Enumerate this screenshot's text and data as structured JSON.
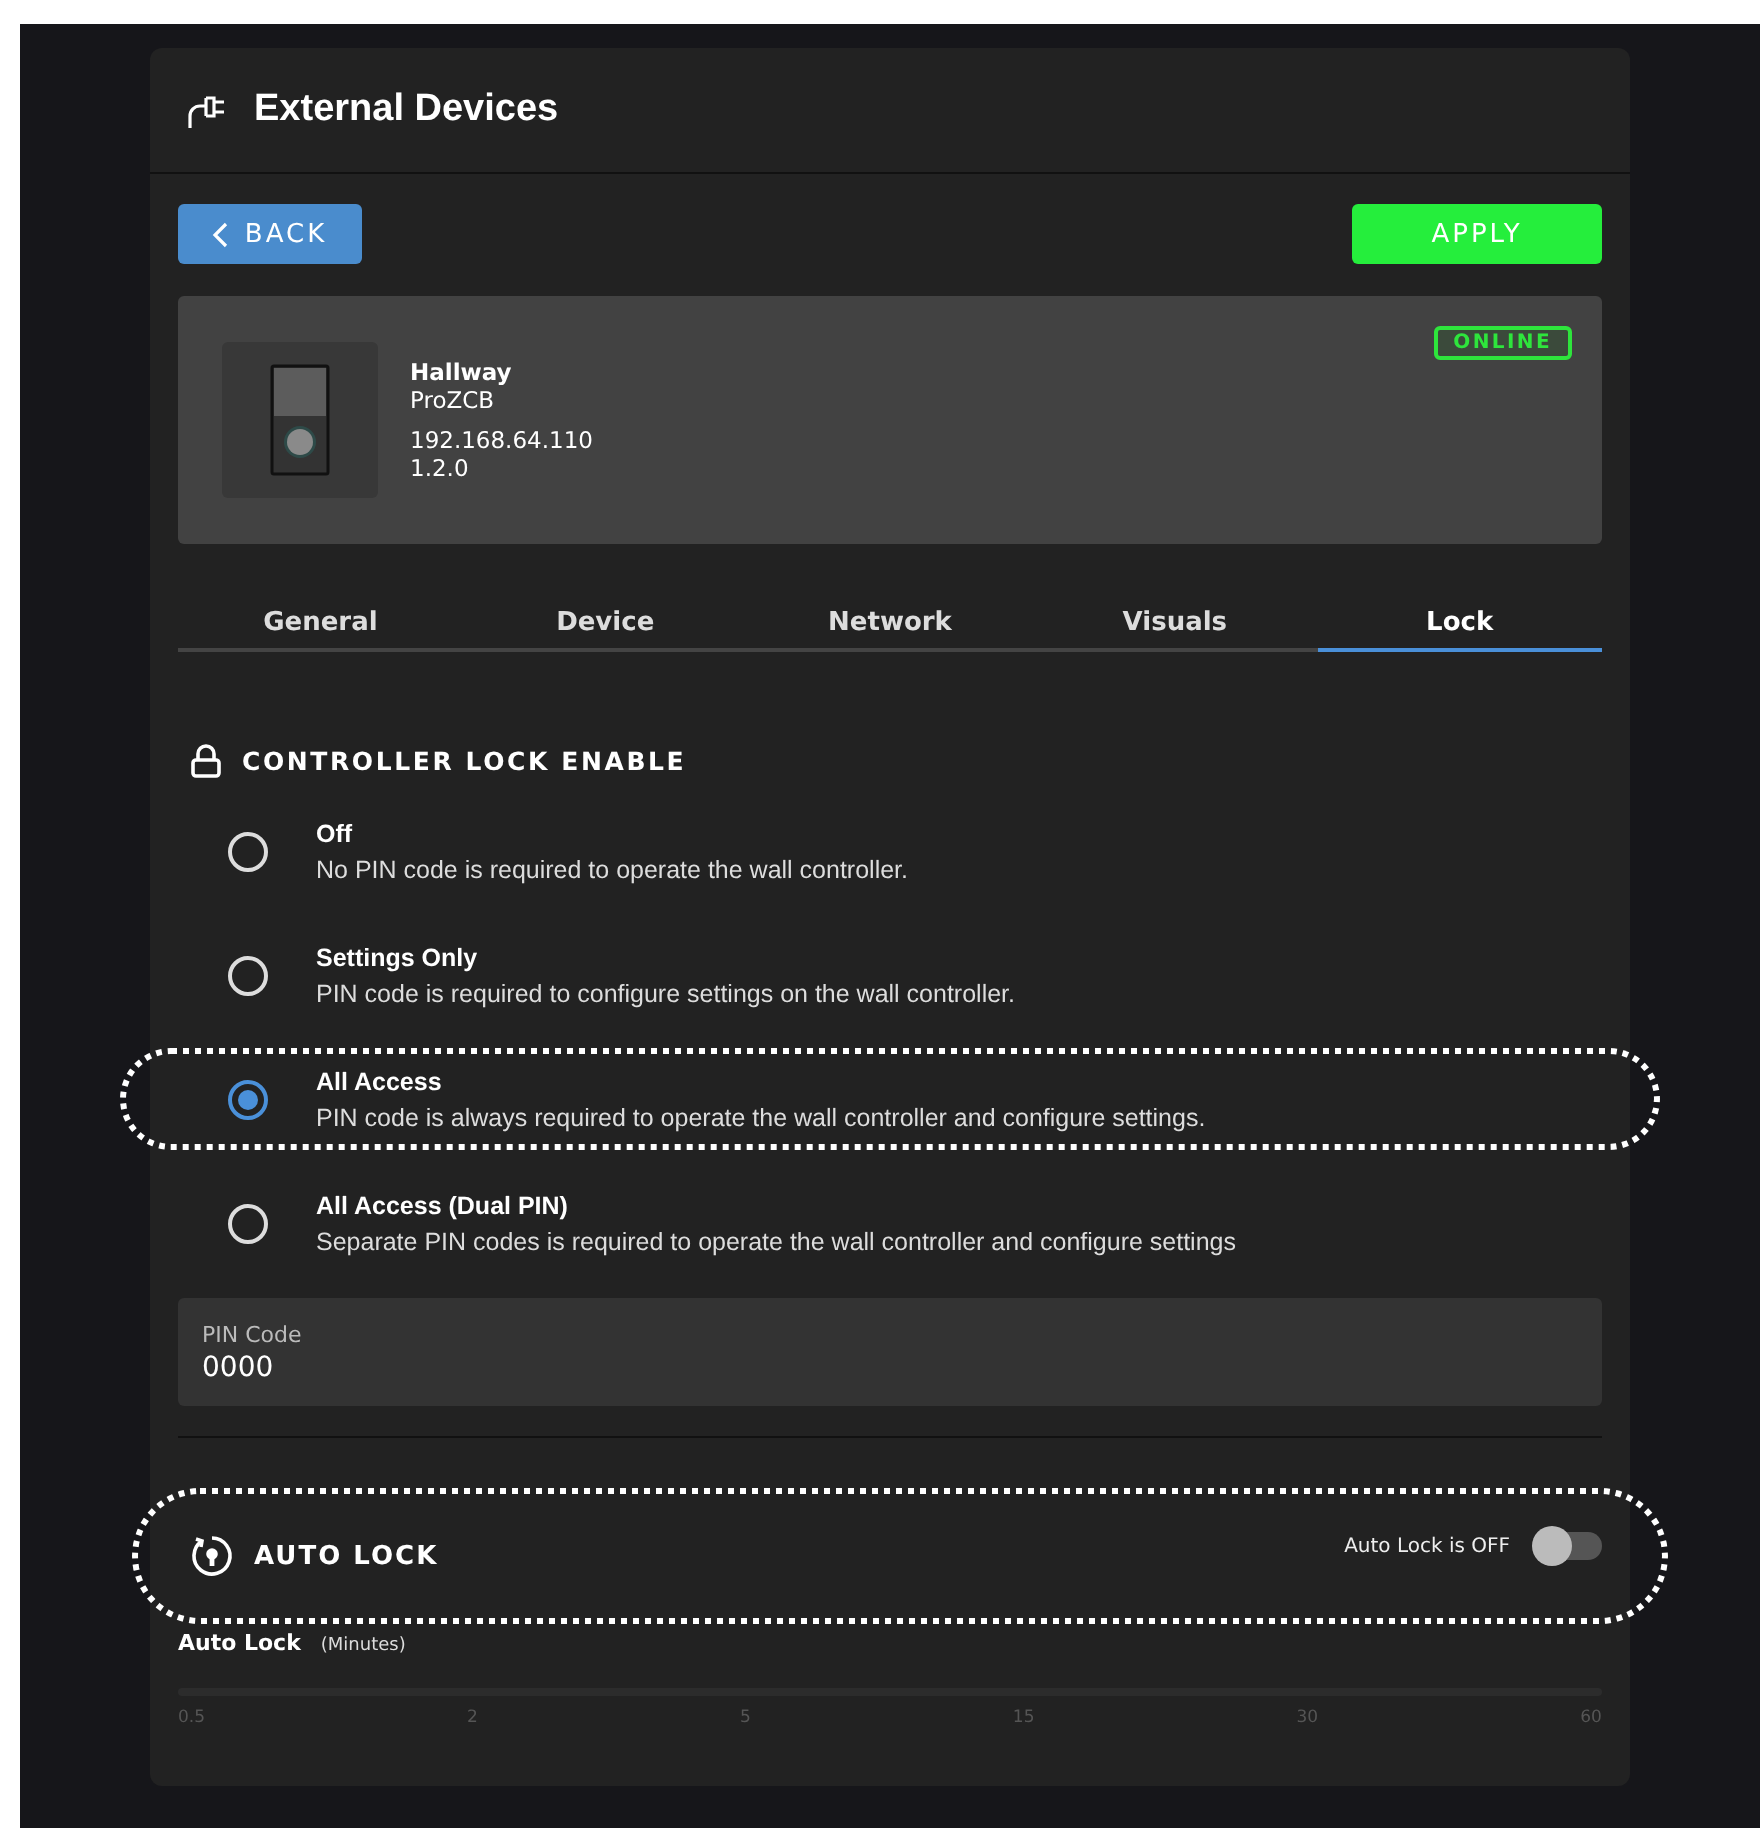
{
  "header": {
    "title": "External Devices"
  },
  "actions": {
    "back": "BACK",
    "apply": "APPLY"
  },
  "device": {
    "name": "Hallway",
    "model": "ProZCB",
    "ip": "192.168.64.110",
    "version": "1.2.0",
    "status": "ONLINE"
  },
  "tabs": [
    {
      "label": "General",
      "selected": false
    },
    {
      "label": "Device",
      "selected": false
    },
    {
      "label": "Network",
      "selected": false
    },
    {
      "label": "Visuals",
      "selected": false
    },
    {
      "label": "Lock",
      "selected": true
    }
  ],
  "lock_section": {
    "title": "CONTROLLER LOCK ENABLE",
    "options": [
      {
        "label": "Off",
        "description": "No PIN code is required to operate the wall controller.",
        "selected": false,
        "highlighted": false
      },
      {
        "label": "Settings Only",
        "description": "PIN code is required to configure settings on the wall controller.",
        "selected": false,
        "highlighted": false
      },
      {
        "label": "All Access",
        "description": "PIN code is always required to operate the wall controller and configure settings.",
        "selected": true,
        "highlighted": true
      },
      {
        "label": "All Access (Dual PIN)",
        "description": "Separate PIN codes is required to operate the wall controller and configure settings",
        "selected": false,
        "highlighted": false
      }
    ]
  },
  "pin_field": {
    "label": "PIN Code",
    "value": "0000"
  },
  "auto_lock": {
    "title": "AUTO LOCK",
    "highlighted": true,
    "toggle_label": "Auto Lock is OFF",
    "on": false,
    "slider_label": "Auto Lock",
    "slider_unit": "(Minutes)",
    "ticks": [
      "0.5",
      "2",
      "5",
      "15",
      "30",
      "60"
    ]
  }
}
